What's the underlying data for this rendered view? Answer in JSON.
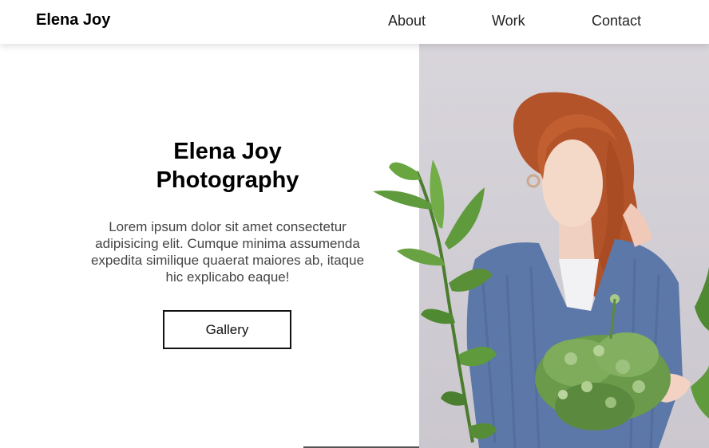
{
  "navbar": {
    "brand": "Elena Joy",
    "links": [
      {
        "label": "About"
      },
      {
        "label": "Work"
      },
      {
        "label": "Contact"
      }
    ]
  },
  "hero": {
    "title_line1": "Elena Joy",
    "title_line2": "Photography",
    "description": "Lorem ipsum dolor sit amet consectetur adipisicing elit. Cumque minima assumenda expedita similique quaerat maiores ab, itaque hic explicabo eaque!",
    "button_label": "Gallery"
  },
  "colors": {
    "photo_background": "#d3cfd6",
    "sweater": "#5b78a8",
    "hair": "#b9562a",
    "leaf": "#5f9a3c"
  },
  "icons": {
    "hero_image": "portrait-photo"
  }
}
